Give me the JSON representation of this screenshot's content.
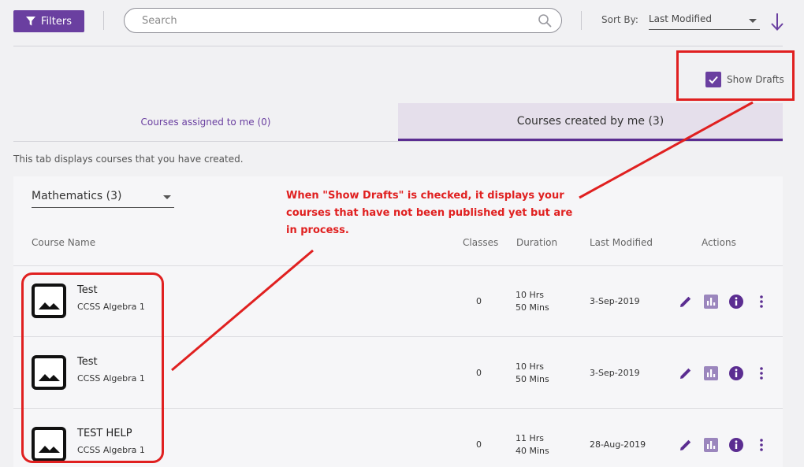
{
  "toolbar": {
    "filters_label": "Filters",
    "search_placeholder": "Search",
    "sort_label": "Sort By:",
    "sort_value": "Last Modified"
  },
  "drafts": {
    "label": "Show Drafts",
    "checked": true
  },
  "tabs": [
    {
      "label": "Courses assigned to me (0)",
      "active": false
    },
    {
      "label": "Courses created by me (3)",
      "active": true
    }
  ],
  "description": "This tab displays courses that you have created.",
  "subject_filter": {
    "value": "Mathematics (3)"
  },
  "table": {
    "headers": {
      "course_name": "Course Name",
      "classes": "Classes",
      "duration": "Duration",
      "last_modified": "Last Modified",
      "actions": "Actions"
    },
    "rows": [
      {
        "title": "Test",
        "subtitle": "CCSS Algebra 1",
        "classes": "0",
        "duration_hrs": "10 Hrs",
        "duration_mins": "50 Mins",
        "last_modified": "3-Sep-2019"
      },
      {
        "title": "Test",
        "subtitle": "CCSS Algebra 1",
        "classes": "0",
        "duration_hrs": "10 Hrs",
        "duration_mins": "50 Mins",
        "last_modified": "3-Sep-2019"
      },
      {
        "title": "TEST HELP",
        "subtitle": "CCSS Algebra 1",
        "classes": "0",
        "duration_hrs": "11 Hrs",
        "duration_mins": "40 Mins",
        "last_modified": "28-Aug-2019"
      }
    ]
  },
  "annotation": {
    "text": "When \"Show Drafts\" is checked, it displays your courses that have not been published yet but are in process.",
    "color": "#e02020"
  },
  "colors": {
    "accent": "#6a3fa0",
    "tab_active_bg": "#e5dfeb",
    "tab_underline": "#5b2d91"
  },
  "icons": {
    "filters": "funnel-icon",
    "search": "search-icon",
    "sort_direction": "arrow-down-icon",
    "checkbox": "check-icon",
    "thumbnail": "image-icon",
    "edit": "pencil-icon",
    "stats": "bar-chart-icon",
    "info": "info-icon",
    "more": "more-vert-icon"
  }
}
